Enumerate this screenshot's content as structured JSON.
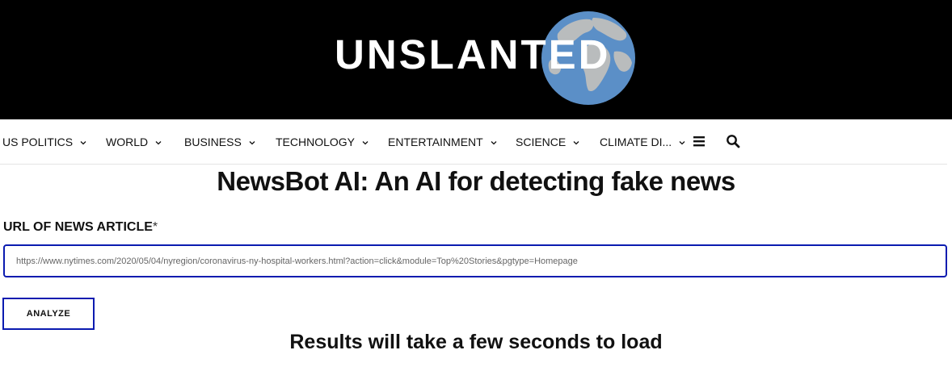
{
  "brand": {
    "name": "UNSLANTED",
    "logo_icon": "globe-icon"
  },
  "nav": {
    "items": [
      {
        "label": "US POLITICS"
      },
      {
        "label": "WORLD"
      },
      {
        "label": "BUSINESS"
      },
      {
        "label": "TECHNOLOGY"
      },
      {
        "label": "ENTERTAINMENT"
      },
      {
        "label": "SCIENCE"
      },
      {
        "label": "CLIMATE DI..."
      }
    ],
    "menu_icon": "hamburger-menu-icon",
    "search_icon": "search-icon"
  },
  "main": {
    "title": "NewsBot AI: An AI for detecting fake news",
    "url_field": {
      "label": "URL OF NEWS ARTICLE",
      "required_marker": "*",
      "value": "https://www.nytimes.com/2020/05/04/nyregion/coronavirus-ny-hospital-workers.html?action=click&module=Top%20Stories&pgtype=Homepage"
    },
    "analyze_button": "ANALYZE",
    "results_message": "Results will take a few seconds to load"
  },
  "colors": {
    "header_bg": "#000000",
    "accent_border": "#0b1bb0",
    "globe_ocean": "#5b8fc7",
    "globe_land": "#b9bcbd"
  }
}
